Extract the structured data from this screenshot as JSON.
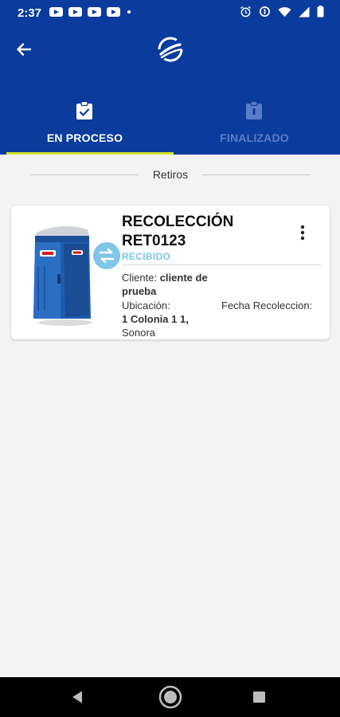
{
  "status_bar": {
    "time": "2:37"
  },
  "tabs": [
    {
      "label": "EN PROCESO",
      "active": true
    },
    {
      "label": "FINALIZADO",
      "active": false
    }
  ],
  "section": {
    "title": "Retiros"
  },
  "card": {
    "title": "RECOLECCIÓN",
    "code": "RET0123",
    "status": "RECIBIDO",
    "cliente_label": "Cliente:",
    "cliente_value": "cliente de prueba",
    "ubicacion_label": "Ubicación:",
    "ubicacion_value": "1 Colonia 1 1,",
    "ubicacion_value2": "Sonora",
    "fecha_label": "Fecha Recoleccion:"
  },
  "colors": {
    "primary": "#0a3c9e",
    "tab_indicator": "#d4e02a",
    "status_accent": "#7fc6ea",
    "inactive_tab": "#5a7cc7"
  },
  "icons": {
    "back": "arrow-left-icon",
    "logo": "brand-logo-icon",
    "tab_en_proceso": "clipboard-check-icon",
    "tab_finalizado": "clipboard-icon",
    "swap": "swap-arrows-icon",
    "menu": "more-vert-icon"
  }
}
